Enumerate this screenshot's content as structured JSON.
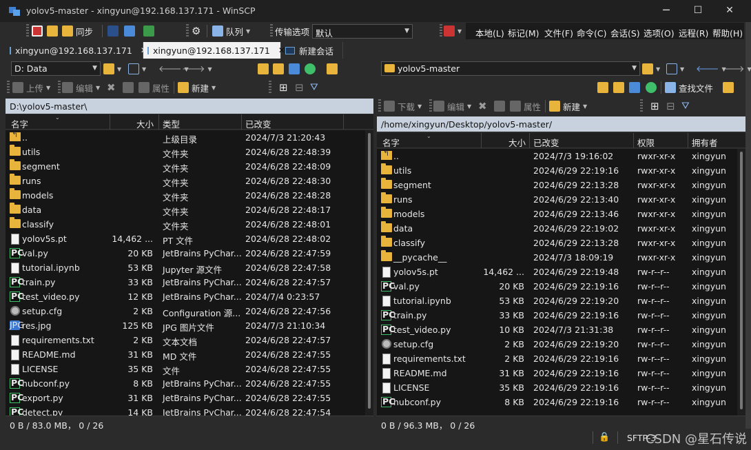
{
  "window": {
    "title": "yolov5-master - xingyun@192.168.137.171 - WinSCP",
    "minimize": "─",
    "maximize": "☐",
    "close": "✕"
  },
  "toolbar": {
    "sync_label": "同步",
    "queue_label": "队列",
    "transfer_options_label": "传输选项",
    "transfer_preset": "默认"
  },
  "menu": [
    "本地(L)",
    "标记(M)",
    "文件(F)",
    "命令(C)",
    "会话(S)",
    "选项(O)",
    "远程(R)",
    "帮助(H)"
  ],
  "tabs": [
    {
      "label": "xingyun@192.168.137.171",
      "close": "✕",
      "active": false
    },
    {
      "label": "xingyun@192.168.137.171",
      "close": "✕",
      "active": true
    },
    {
      "label": "新建会话",
      "active": false
    }
  ],
  "local": {
    "drive": "D: Data",
    "upload": "上传",
    "edit": "编辑",
    "properties": "属性",
    "new": "新建",
    "path": "D:\\yolov5-master\\",
    "columns": [
      "名字",
      "大小",
      "类型",
      "已改变"
    ],
    "rows": [
      {
        "icon": "up",
        "name": "..",
        "size": "",
        "type": "上级目录",
        "changed": "2024/7/3  21:20:43"
      },
      {
        "icon": "folder",
        "name": "utils",
        "size": "",
        "type": "文件夹",
        "changed": "2024/6/28  22:48:39"
      },
      {
        "icon": "folder",
        "name": "segment",
        "size": "",
        "type": "文件夹",
        "changed": "2024/6/28  22:48:09"
      },
      {
        "icon": "folder",
        "name": "runs",
        "size": "",
        "type": "文件夹",
        "changed": "2024/6/28  22:48:30"
      },
      {
        "icon": "folder",
        "name": "models",
        "size": "",
        "type": "文件夹",
        "changed": "2024/6/28  22:48:28"
      },
      {
        "icon": "folder",
        "name": "data",
        "size": "",
        "type": "文件夹",
        "changed": "2024/6/28  22:48:17"
      },
      {
        "icon": "folder",
        "name": "classify",
        "size": "",
        "type": "文件夹",
        "changed": "2024/6/28  22:48:01"
      },
      {
        "icon": "file",
        "name": "yolov5s.pt",
        "size": "14,462 ...",
        "type": "PT 文件",
        "changed": "2024/6/28  22:48:02"
      },
      {
        "icon": "py",
        "name": "val.py",
        "size": "20 KB",
        "type": "JetBrains PyChar...",
        "changed": "2024/6/28  22:47:59"
      },
      {
        "icon": "file",
        "name": "tutorial.ipynb",
        "size": "53 KB",
        "type": "Jupyter 源文件",
        "changed": "2024/6/28  22:47:58"
      },
      {
        "icon": "py",
        "name": "train.py",
        "size": "33 KB",
        "type": "JetBrains PyChar...",
        "changed": "2024/6/28  22:47:57"
      },
      {
        "icon": "py",
        "name": "test_video.py",
        "size": "12 KB",
        "type": "JetBrains PyChar...",
        "changed": "2024/7/4  0:23:57"
      },
      {
        "icon": "cfg",
        "name": "setup.cfg",
        "size": "2 KB",
        "type": "Configuration 源...",
        "changed": "2024/6/28  22:47:56"
      },
      {
        "icon": "jpg",
        "name": "res.jpg",
        "size": "125 KB",
        "type": "JPG 图片文件",
        "changed": "2024/7/3  21:10:34"
      },
      {
        "icon": "file",
        "name": "requirements.txt",
        "size": "2 KB",
        "type": "文本文档",
        "changed": "2024/6/28  22:47:57"
      },
      {
        "icon": "file",
        "name": "README.md",
        "size": "31 KB",
        "type": "MD 文件",
        "changed": "2024/6/28  22:47:55"
      },
      {
        "icon": "file",
        "name": "LICENSE",
        "size": "35 KB",
        "type": "文件",
        "changed": "2024/6/28  22:47:55"
      },
      {
        "icon": "py",
        "name": "hubconf.py",
        "size": "8 KB",
        "type": "JetBrains PyChar...",
        "changed": "2024/6/28  22:47:55"
      },
      {
        "icon": "py",
        "name": "export.py",
        "size": "31 KB",
        "type": "JetBrains PyChar...",
        "changed": "2024/6/28  22:47:55"
      },
      {
        "icon": "py",
        "name": "detect.py",
        "size": "14 KB",
        "type": "JetBrains PyChar...",
        "changed": "2024/6/28  22:47:54"
      }
    ],
    "status": "0 B / 83.0 MB， 0 / 26"
  },
  "remote": {
    "folder": "yolov5-master",
    "download": "下载",
    "edit": "编辑",
    "properties": "属性",
    "new": "新建",
    "find": "查找文件",
    "path": "/home/xingyun/Desktop/yolov5-master/",
    "columns": [
      "名字",
      "大小",
      "已改变",
      "权限",
      "拥有者"
    ],
    "rows": [
      {
        "icon": "up",
        "name": "..",
        "size": "",
        "changed": "2024/7/3 19:16:02",
        "perm": "rwxr-xr-x",
        "owner": "xingyun"
      },
      {
        "icon": "folder",
        "name": "utils",
        "size": "",
        "changed": "2024/6/29 22:19:16",
        "perm": "rwxr-xr-x",
        "owner": "xingyun"
      },
      {
        "icon": "folder",
        "name": "segment",
        "size": "",
        "changed": "2024/6/29 22:13:28",
        "perm": "rwxr-xr-x",
        "owner": "xingyun"
      },
      {
        "icon": "folder",
        "name": "runs",
        "size": "",
        "changed": "2024/6/29 22:13:40",
        "perm": "rwxr-xr-x",
        "owner": "xingyun"
      },
      {
        "icon": "folder",
        "name": "models",
        "size": "",
        "changed": "2024/6/29 22:13:46",
        "perm": "rwxr-xr-x",
        "owner": "xingyun"
      },
      {
        "icon": "folder",
        "name": "data",
        "size": "",
        "changed": "2024/6/29 22:19:02",
        "perm": "rwxr-xr-x",
        "owner": "xingyun"
      },
      {
        "icon": "folder",
        "name": "classify",
        "size": "",
        "changed": "2024/6/29 22:13:28",
        "perm": "rwxr-xr-x",
        "owner": "xingyun"
      },
      {
        "icon": "folder",
        "name": "__pycache__",
        "size": "",
        "changed": "2024/7/3 18:09:19",
        "perm": "rwxr-xr-x",
        "owner": "xingyun"
      },
      {
        "icon": "file",
        "name": "yolov5s.pt",
        "size": "14,462 ...",
        "changed": "2024/6/29 22:19:48",
        "perm": "rw-r--r--",
        "owner": "xingyun"
      },
      {
        "icon": "py",
        "name": "val.py",
        "size": "20 KB",
        "changed": "2024/6/29 22:19:16",
        "perm": "rw-r--r--",
        "owner": "xingyun"
      },
      {
        "icon": "file",
        "name": "tutorial.ipynb",
        "size": "53 KB",
        "changed": "2024/6/29 22:19:20",
        "perm": "rw-r--r--",
        "owner": "xingyun"
      },
      {
        "icon": "py",
        "name": "train.py",
        "size": "33 KB",
        "changed": "2024/6/29 22:19:16",
        "perm": "rw-r--r--",
        "owner": "xingyun"
      },
      {
        "icon": "py",
        "name": "test_video.py",
        "size": "10 KB",
        "changed": "2024/7/3 21:31:38",
        "perm": "rw-r--r--",
        "owner": "xingyun"
      },
      {
        "icon": "cfg",
        "name": "setup.cfg",
        "size": "2 KB",
        "changed": "2024/6/29 22:19:20",
        "perm": "rw-r--r--",
        "owner": "xingyun"
      },
      {
        "icon": "file",
        "name": "requirements.txt",
        "size": "2 KB",
        "changed": "2024/6/29 22:19:16",
        "perm": "rw-r--r--",
        "owner": "xingyun"
      },
      {
        "icon": "file",
        "name": "README.md",
        "size": "31 KB",
        "changed": "2024/6/29 22:19:16",
        "perm": "rw-r--r--",
        "owner": "xingyun"
      },
      {
        "icon": "file",
        "name": "LICENSE",
        "size": "35 KB",
        "changed": "2024/6/29 22:19:16",
        "perm": "rw-r--r--",
        "owner": "xingyun"
      },
      {
        "icon": "py",
        "name": "hubconf.py",
        "size": "8 KB",
        "changed": "2024/6/29 22:19:16",
        "perm": "rw-r--r--",
        "owner": "xingyun"
      }
    ],
    "status": "0 B / 96.3 MB， 0 / 26"
  },
  "statusbar": {
    "protocol": "SFTP-3",
    "watermark": "CSDN @星石传说"
  },
  "colors": {
    "path_bar": "#c8d2de",
    "folder": "#e8b43c",
    "python_icon": "#3fbf6a",
    "list_bg": "#161616"
  }
}
